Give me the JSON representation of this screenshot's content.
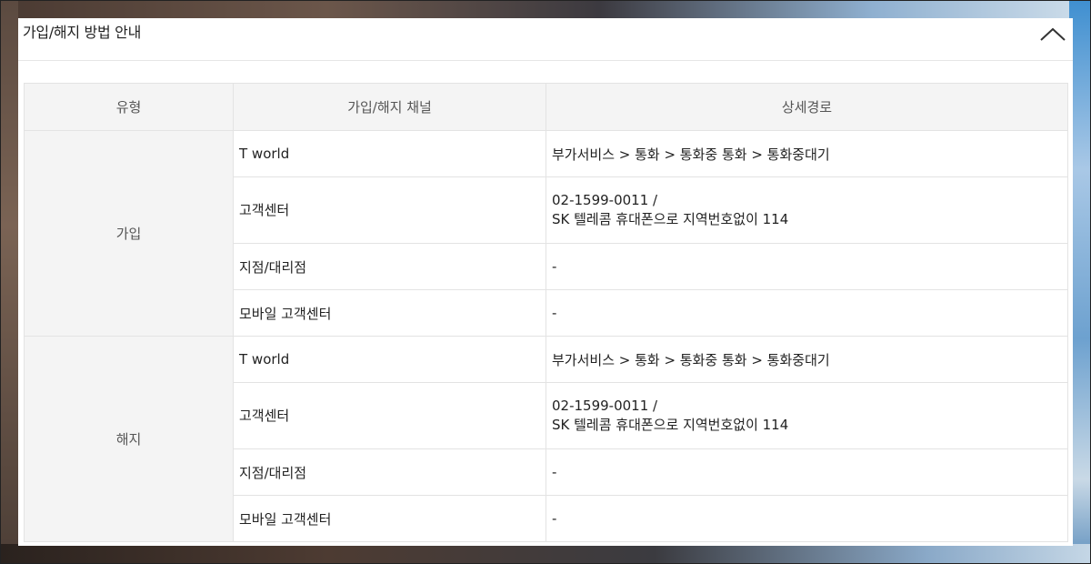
{
  "panel": {
    "title": "가입/해지 방법 안내",
    "collapse_icon": "chevron-up-icon"
  },
  "table": {
    "headers": [
      "유형",
      "가입/해지 채널",
      "상세경로"
    ],
    "groups": [
      {
        "type": "가입",
        "rows": [
          {
            "channel": "T world",
            "detail_lines": [
              "부가서비스 > 통화 > 통화중 통화 > 통화중대기"
            ]
          },
          {
            "channel": "고객센터",
            "detail_lines": [
              "02-1599-0011 /",
              "SK 텔레콤 휴대폰으로 지역번호없이 114"
            ]
          },
          {
            "channel": "지점/대리점",
            "detail_lines": [
              "-"
            ]
          },
          {
            "channel": "모바일 고객센터",
            "detail_lines": [
              "-"
            ]
          }
        ]
      },
      {
        "type": "해지",
        "rows": [
          {
            "channel": "T world",
            "detail_lines": [
              "부가서비스 > 통화 > 통화중 통화 > 통화중대기"
            ]
          },
          {
            "channel": "고객센터",
            "detail_lines": [
              "02-1599-0011 /",
              "SK 텔레콤 휴대폰으로 지역번호없이 114"
            ]
          },
          {
            "channel": "지점/대리점",
            "detail_lines": [
              "-"
            ]
          },
          {
            "channel": "모바일 고객센터",
            "detail_lines": [
              "-"
            ]
          }
        ]
      }
    ]
  }
}
